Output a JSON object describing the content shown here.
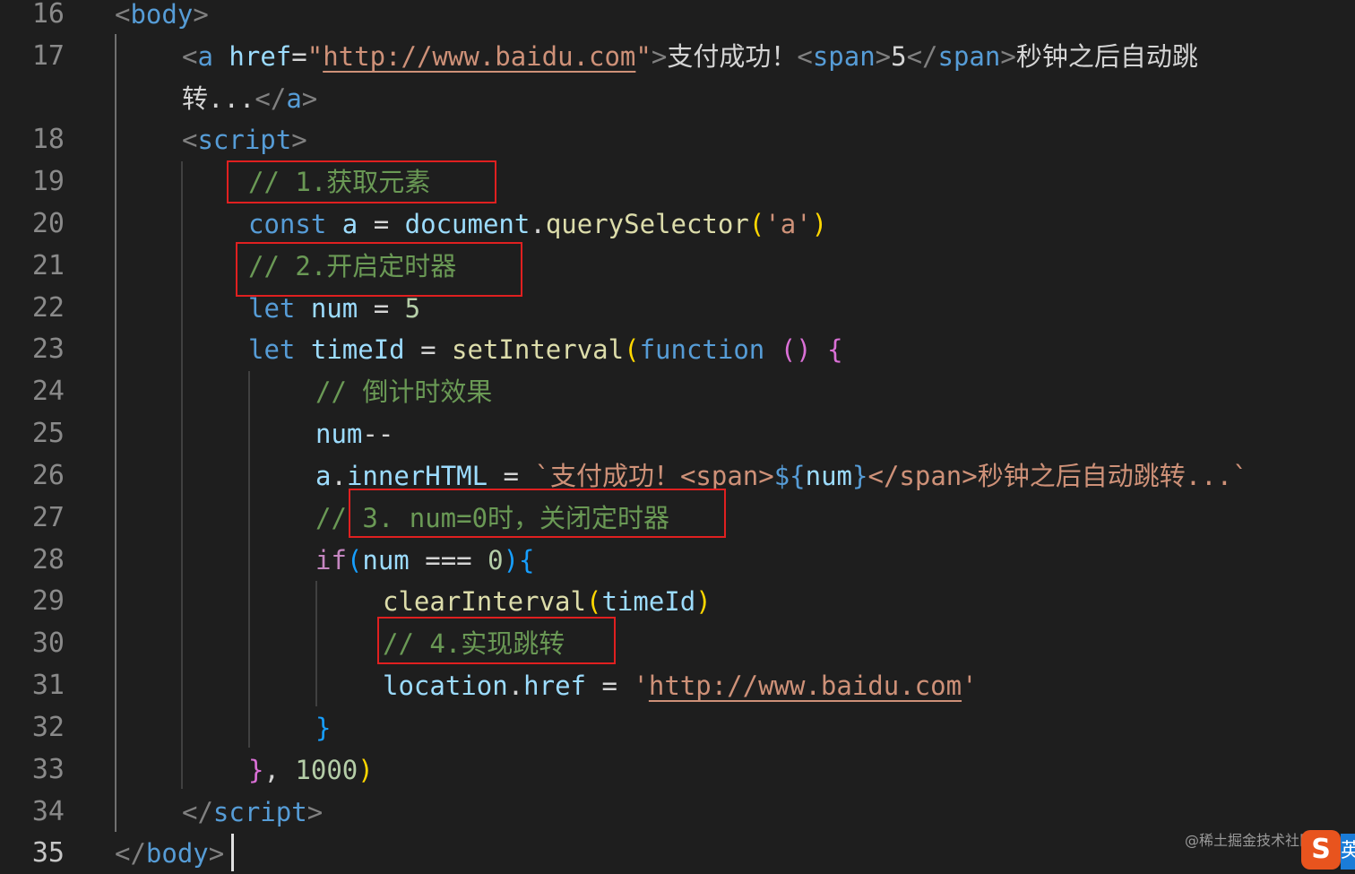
{
  "editor": {
    "language": "html",
    "active_line": 35,
    "line_numbers": [
      "16",
      "17",
      "",
      "18",
      "19",
      "20",
      "21",
      "22",
      "23",
      "24",
      "25",
      "26",
      "27",
      "28",
      "29",
      "30",
      "31",
      "32",
      "33",
      "34",
      "35"
    ],
    "lines": {
      "l16": {
        "open": "<",
        "tag": "body",
        "close": ">"
      },
      "l17": {
        "lt1": "<",
        "tag_a": "a",
        "sp": " ",
        "attr_href": "href",
        "eq": "=",
        "q1": "\"",
        "url": "http://www.baidu.com",
        "q2": "\"",
        "gt1": ">",
        "text1": "支付成功！",
        "lt2": "<",
        "tag_span1": "span",
        "gt2": ">",
        "five": "5",
        "lt3": "</",
        "tag_span2": "span",
        "gt3": ">",
        "text2": "秒钟之后自动跳"
      },
      "l17b": {
        "text": "转...",
        "lt": "</",
        "tag": "a",
        "gt": ">"
      },
      "l18": {
        "open": "<",
        "tag": "script",
        "close": ">"
      },
      "l19": {
        "comment": "// 1.获取元素"
      },
      "l20": {
        "kw": "const",
        "var": "a",
        "op": "=",
        "obj": "document",
        "dot": ".",
        "fn": "querySelector",
        "p1": "(",
        "str": "'a'",
        "p2": ")"
      },
      "l21": {
        "comment": "// 2.开启定时器"
      },
      "l22": {
        "kw": "let",
        "var": "num",
        "op": "=",
        "num": "5"
      },
      "l23": {
        "kw": "let",
        "var": "timeId",
        "op": "=",
        "fn": "setInterval",
        "p1": "(",
        "fkw": "function",
        "p2": "()",
        "b1": "{"
      },
      "l24": {
        "comment": "// 倒计时效果"
      },
      "l25": {
        "var": "num",
        "op": "--"
      },
      "l26": {
        "obj": "a",
        "dot": ".",
        "prop": "innerHTML",
        "op": "=",
        "tpl1": "`支付成功！<span>",
        "dl": "${",
        "var": "num",
        "dr": "}",
        "tpl2": "</span>秒钟之后自动跳转...`"
      },
      "l27": {
        "comment": "// 3. num=0时，关闭定时器"
      },
      "l28": {
        "kw": "if",
        "p1": "(",
        "var": "num",
        "op": "===",
        "num": "0",
        "p2": ")",
        "b1": "{"
      },
      "l29": {
        "fn": "clearInterval",
        "p1": "(",
        "var": "timeId",
        "p2": ")"
      },
      "l30": {
        "comment": "// 4.实现跳转"
      },
      "l31": {
        "obj": "location",
        "dot": ".",
        "prop": "href",
        "op": "=",
        "q1": "'",
        "url": "http://www.baidu.com",
        "q2": "'"
      },
      "l32": {
        "b1": "}"
      },
      "l33": {
        "b1": "}",
        "comma": ",",
        "num": "1000",
        "p2": ")"
      },
      "l34": {
        "open": "</",
        "tag": "script",
        "close": ">"
      },
      "l35": {
        "open": "</",
        "tag": "body",
        "close": ">"
      }
    }
  },
  "watermark": {
    "text": "@稀土掘金技术社区",
    "logo_glyph": "S",
    "logo_glyph_2": "英"
  },
  "colors": {
    "background": "#1e1e1e",
    "highlight_box": "#e02020",
    "comment": "#6a9955",
    "keyword": "#569cd6",
    "string": "#ce9178"
  }
}
